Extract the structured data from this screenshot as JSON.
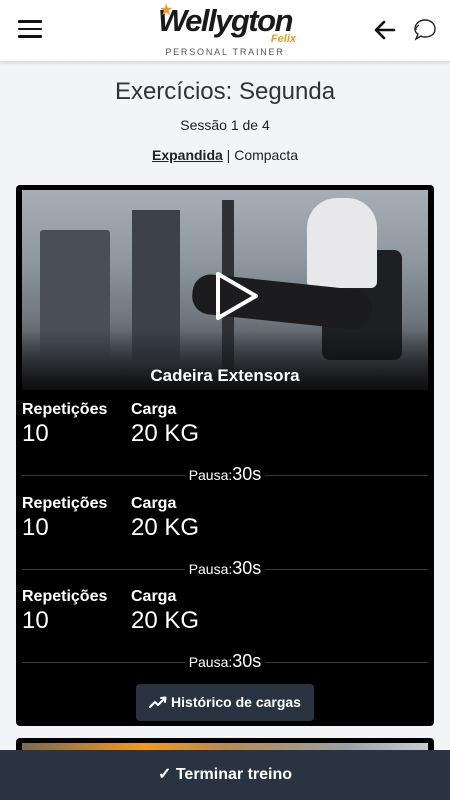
{
  "header": {
    "logo": {
      "name": "Wellygton",
      "surname": "Felix",
      "subtitle": "PERSONAL TRAINER"
    },
    "icons": {
      "menu": "hamburger-icon",
      "back": "arrow-left-icon",
      "chat": "chat-bubble-icon"
    }
  },
  "page": {
    "title": "Exercícios: Segunda",
    "session": "Sessão 1 de 4",
    "view_modes": {
      "expanded": "Expandida",
      "separator": "|",
      "compact": "Compacta",
      "selected": "Expandida"
    }
  },
  "exercise": {
    "name": "Cadeira Extensora",
    "video_icon": "play-icon",
    "sets": [
      {
        "reps_label": "Repetições",
        "reps": "10",
        "load_label": "Carga",
        "load": "20 KG",
        "pause_label": "Pausa:",
        "pause": "30s"
      },
      {
        "reps_label": "Repetições",
        "reps": "10",
        "load_label": "Carga",
        "load": "20 KG",
        "pause_label": "Pausa:",
        "pause": "30s"
      },
      {
        "reps_label": "Repetições",
        "reps": "10",
        "load_label": "Carga",
        "load": "20 KG",
        "pause_label": "Pausa:",
        "pause": "30s"
      }
    ],
    "history_button": "Histórico de cargas",
    "history_icon": "trending-up-icon"
  },
  "footer": {
    "finish_button": "✓ Terminar treino"
  },
  "colors": {
    "accent": "#f39a1e",
    "dark_button": "#2a3342",
    "card_bg": "#000000",
    "page_bg": "#f3f4f8"
  }
}
